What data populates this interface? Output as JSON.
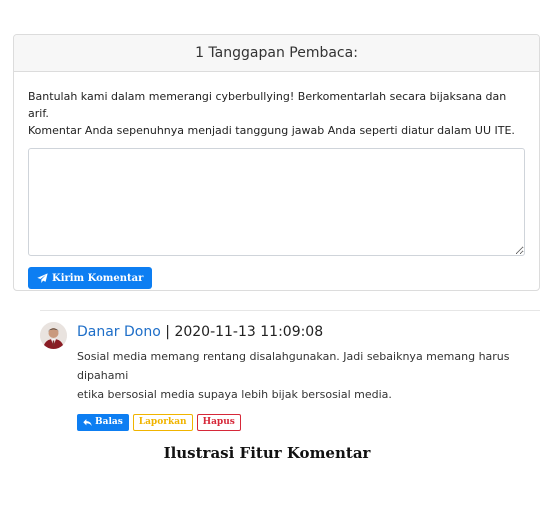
{
  "comments_section": {
    "header_title": "1 Tanggapan Pembaca:",
    "notice_line1": "Bantulah kami dalam memerangi cyberbullying! Berkomentarlah secara bijaksana dan arif.",
    "notice_line2": "Komentar Anda sepenuhnya menjadi tanggung jawab Anda seperti diatur dalam UU ITE.",
    "textarea_value": "",
    "submit_label": "Kirim Komentar",
    "submit_icon": "paper-plane-icon"
  },
  "comment": {
    "author": "Danar Dono",
    "separator": " | ",
    "timestamp": "2020-11-13 11:09:08",
    "text_line1": "Sosial media memang rentang disalahgunakan. Jadi sebaiknya memang harus dipahami",
    "text_line2": "etika bersosial media supaya lebih bijak bersosial media.",
    "actions": {
      "reply_label": "Balas",
      "reply_icon": "reply-icon",
      "report_label": "Laporkan",
      "delete_label": "Hapus"
    }
  },
  "caption": "Ilustrasi Fitur Komentar",
  "colors": {
    "primary": "#0d7ef2",
    "warning": "#f0b400",
    "danger": "#d62839",
    "author_link": "#1e6ec8"
  }
}
